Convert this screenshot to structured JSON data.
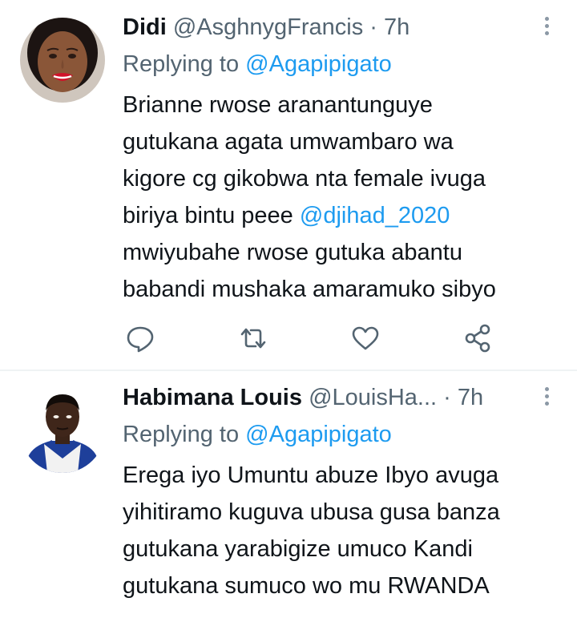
{
  "tweets": [
    {
      "name": "Didi",
      "handle": "@AsghnygFrancis",
      "separator": "·",
      "time": "7h",
      "replying_prefix": "Replying to",
      "replying_to": "@Agapipigato",
      "body_lines": [
        "Brianne rwose aranantunguye",
        "gutukana agata umwambaro wa",
        "kigore cg gikobwa nta female ivuga",
        "biriya bintu peee ",
        "mwiyubahe rwose gutuka abantu",
        "babandi mushaka amaramuko sibyo"
      ],
      "body_mention": "@djihad_2020",
      "actions": [
        "reply-icon",
        "retweet-icon",
        "like-icon",
        "share-icon"
      ]
    },
    {
      "name": "Habimana Louis",
      "handle": "@LouisHa...",
      "separator": "·",
      "time": "7h",
      "replying_prefix": "Replying to",
      "replying_to": "@Agapipigato",
      "body_lines": [
        "Erega iyo Umuntu abuze Ibyo avuga",
        "yihitiramo kuguva ubusa gusa banza",
        "gutukana yarabigize umuco Kandi",
        "gutukana sumuco wo mu RWANDA"
      ]
    }
  ],
  "colors": {
    "text": "#0f1419",
    "secondary": "#536471",
    "accent": "#1d9bf0",
    "divider": "#eff3f4"
  }
}
